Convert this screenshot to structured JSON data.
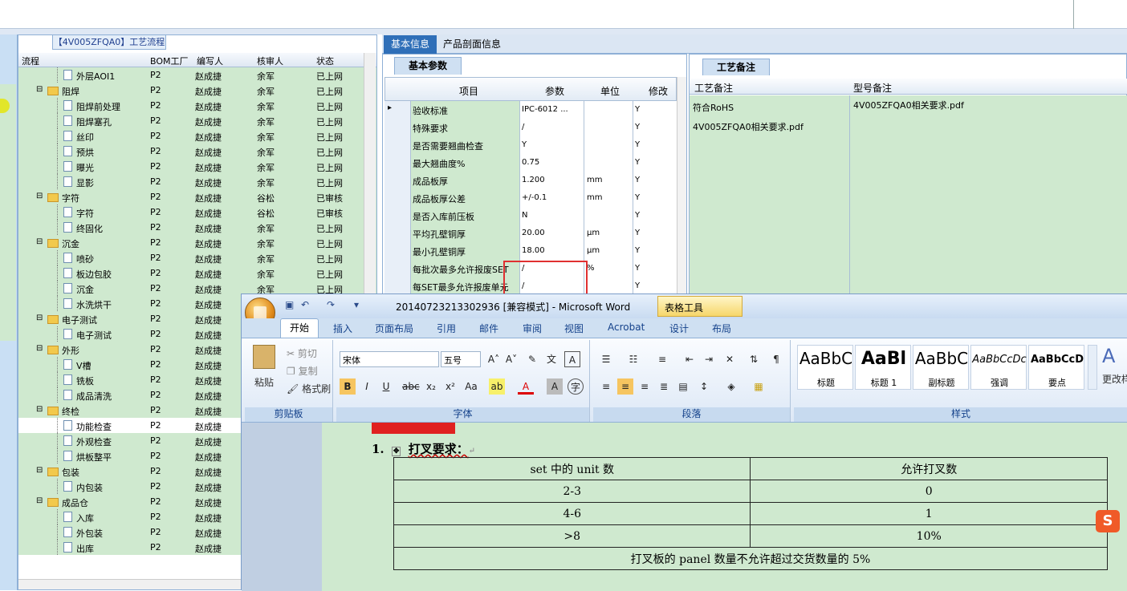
{
  "tree": {
    "tab_title": "【4V005ZFQA0】工艺流程",
    "columns": [
      "流程",
      "BOM工厂",
      "编写人",
      "核审人",
      "状态"
    ],
    "rows": [
      {
        "name": "外层AOI1",
        "level": 2,
        "bom": "P2",
        "writer": "赵成捷",
        "reviewer": "余军",
        "status": "已上网"
      },
      {
        "name": "阻焊",
        "level": 1,
        "bom": "P2",
        "writer": "赵成捷",
        "reviewer": "余军",
        "status": "已上网"
      },
      {
        "name": "阻焊前处理",
        "level": 2,
        "bom": "P2",
        "writer": "赵成捷",
        "reviewer": "余军",
        "status": "已上网"
      },
      {
        "name": "阻焊塞孔",
        "level": 2,
        "bom": "P2",
        "writer": "赵成捷",
        "reviewer": "余军",
        "status": "已上网"
      },
      {
        "name": "丝印",
        "level": 2,
        "bom": "P2",
        "writer": "赵成捷",
        "reviewer": "余军",
        "status": "已上网"
      },
      {
        "name": "预烘",
        "level": 2,
        "bom": "P2",
        "writer": "赵成捷",
        "reviewer": "余军",
        "status": "已上网"
      },
      {
        "name": "曝光",
        "level": 2,
        "bom": "P2",
        "writer": "赵成捷",
        "reviewer": "余军",
        "status": "已上网"
      },
      {
        "name": "显影",
        "level": 2,
        "bom": "P2",
        "writer": "赵成捷",
        "reviewer": "余军",
        "status": "已上网"
      },
      {
        "name": "字符",
        "level": 1,
        "bom": "P2",
        "writer": "赵成捷",
        "reviewer": "谷松",
        "status": "已审核"
      },
      {
        "name": "字符",
        "level": 2,
        "bom": "P2",
        "writer": "赵成捷",
        "reviewer": "谷松",
        "status": "已审核"
      },
      {
        "name": "终固化",
        "level": 2,
        "bom": "P2",
        "writer": "赵成捷",
        "reviewer": "余军",
        "status": "已上网"
      },
      {
        "name": "沉金",
        "level": 1,
        "bom": "P2",
        "writer": "赵成捷",
        "reviewer": "余军",
        "status": "已上网"
      },
      {
        "name": "喷砂",
        "level": 2,
        "bom": "P2",
        "writer": "赵成捷",
        "reviewer": "余军",
        "status": "已上网"
      },
      {
        "name": "板边包胶",
        "level": 2,
        "bom": "P2",
        "writer": "赵成捷",
        "reviewer": "余军",
        "status": "已上网"
      },
      {
        "name": "沉金",
        "level": 2,
        "bom": "P2",
        "writer": "赵成捷",
        "reviewer": "余军",
        "status": "已上网"
      },
      {
        "name": "水洗烘干",
        "level": 2,
        "bom": "P2",
        "writer": "赵成捷",
        "reviewer": "",
        "status": ""
      },
      {
        "name": "电子测试",
        "level": 1,
        "bom": "P2",
        "writer": "赵成捷",
        "reviewer": "",
        "status": ""
      },
      {
        "name": "电子测试",
        "level": 2,
        "bom": "P2",
        "writer": "赵成捷",
        "reviewer": "",
        "status": ""
      },
      {
        "name": "外形",
        "level": 1,
        "bom": "P2",
        "writer": "赵成捷",
        "reviewer": "",
        "status": ""
      },
      {
        "name": "V槽",
        "level": 2,
        "bom": "P2",
        "writer": "赵成捷",
        "reviewer": "",
        "status": ""
      },
      {
        "name": "铣板",
        "level": 2,
        "bom": "P2",
        "writer": "赵成捷",
        "reviewer": "",
        "status": ""
      },
      {
        "name": "成品清洗",
        "level": 2,
        "bom": "P2",
        "writer": "赵成捷",
        "reviewer": "",
        "status": ""
      },
      {
        "name": "终检",
        "level": 1,
        "bom": "P2",
        "writer": "赵成捷",
        "reviewer": "",
        "status": ""
      },
      {
        "name": "功能检查",
        "level": 2,
        "bom": "P2",
        "writer": "赵成捷",
        "reviewer": "",
        "status": "",
        "selected": true
      },
      {
        "name": "外观检查",
        "level": 2,
        "bom": "P2",
        "writer": "赵成捷",
        "reviewer": "",
        "status": ""
      },
      {
        "name": "烘板整平",
        "level": 2,
        "bom": "P2",
        "writer": "赵成捷",
        "reviewer": "",
        "status": ""
      },
      {
        "name": "包装",
        "level": 1,
        "bom": "P2",
        "writer": "赵成捷",
        "reviewer": "",
        "status": ""
      },
      {
        "name": "内包装",
        "level": 2,
        "bom": "P2",
        "writer": "赵成捷",
        "reviewer": "",
        "status": ""
      },
      {
        "name": "成品仓",
        "level": 1,
        "bom": "P2",
        "writer": "赵成捷",
        "reviewer": "",
        "status": ""
      },
      {
        "name": "入库",
        "level": 2,
        "bom": "P2",
        "writer": "赵成捷",
        "reviewer": "",
        "status": ""
      },
      {
        "name": "外包装",
        "level": 2,
        "bom": "P2",
        "writer": "赵成捷",
        "reviewer": "",
        "status": ""
      },
      {
        "name": "出库",
        "level": 2,
        "bom": "P2",
        "writer": "赵成捷",
        "reviewer": "",
        "status": ""
      }
    ]
  },
  "right_tabs": {
    "basic": "基本信息",
    "profile": "产品剖面信息"
  },
  "params": {
    "tab": "基本参数",
    "columns": [
      "项目",
      "参数",
      "单位",
      "修改"
    ],
    "rows": [
      {
        "item": "验收标准",
        "value": "IPC-6012 ...",
        "unit": "",
        "mod": "Y"
      },
      {
        "item": "特殊要求",
        "value": "/",
        "unit": "",
        "mod": "Y"
      },
      {
        "item": "是否需要翘曲检查",
        "value": "Y",
        "unit": "",
        "mod": "Y"
      },
      {
        "item": "最大翘曲度%",
        "value": "0.75",
        "unit": "",
        "mod": "Y"
      },
      {
        "item": "成品板厚",
        "value": "1.200",
        "unit": "mm",
        "mod": "Y"
      },
      {
        "item": "成品板厚公差",
        "value": "+/-0.1",
        "unit": "mm",
        "mod": "Y"
      },
      {
        "item": "是否入库前压板",
        "value": "N",
        "unit": "",
        "mod": "Y"
      },
      {
        "item": "平均孔壁铜厚",
        "value": "20.00",
        "unit": "μm",
        "mod": "Y"
      },
      {
        "item": "最小孔壁铜厚",
        "value": "18.00",
        "unit": "μm",
        "mod": "Y"
      },
      {
        "item": "每批次最多允许报废SET",
        "value": "/",
        "unit": "%",
        "mod": "Y"
      },
      {
        "item": "每SET最多允许报废单元",
        "value": "/",
        "unit": "",
        "mod": "Y"
      }
    ]
  },
  "notes": {
    "tab": "工艺备注",
    "col1": "工艺备注",
    "col2": "型号备注",
    "col1_lines": [
      "符合RoHS",
      "4V005ZFQA0相关要求.pdf"
    ],
    "col2_text": "4V005ZFQA0相关要求.pdf"
  },
  "word": {
    "title": "20140723213302936 [兼容模式] - Microsoft Word",
    "context_tab": "表格工具",
    "tabs": [
      "开始",
      "插入",
      "页面布局",
      "引用",
      "邮件",
      "审阅",
      "视图",
      "Acrobat",
      "设计",
      "布局"
    ],
    "clipboard": {
      "paste": "粘贴",
      "cut": "剪切",
      "copy": "复制",
      "format_painter": "格式刷",
      "label": "剪贴板"
    },
    "font": {
      "name": "宋体",
      "size": "五号",
      "label": "字体"
    },
    "paragraph_label": "段落",
    "styles": {
      "label": "样式",
      "items": [
        {
          "preview": "AaBbC",
          "name": "标题"
        },
        {
          "preview": "AaBl",
          "name": "标题 1"
        },
        {
          "preview": "AaBbC",
          "name": "副标题"
        },
        {
          "preview": "AaBbCcDc",
          "name": "强调"
        },
        {
          "preview": "AaBbCcD",
          "name": "要点"
        }
      ],
      "change": "更改样"
    },
    "doc": {
      "item": "1.",
      "item_text": "打叉要求：",
      "table_header": [
        "set 中的 unit 数",
        "允许打叉数"
      ],
      "table_rows": [
        [
          "2-3",
          "0"
        ],
        [
          "4-6",
          "1"
        ],
        [
          ">8",
          "10%"
        ]
      ],
      "table_footer": "打叉板的 panel 数量不允许超过交货数量的 5%"
    }
  },
  "colors": {
    "row_green": "#cfe9cf",
    "tab_blue": "#2f6fb8",
    "highlight_red": "#e03030"
  }
}
